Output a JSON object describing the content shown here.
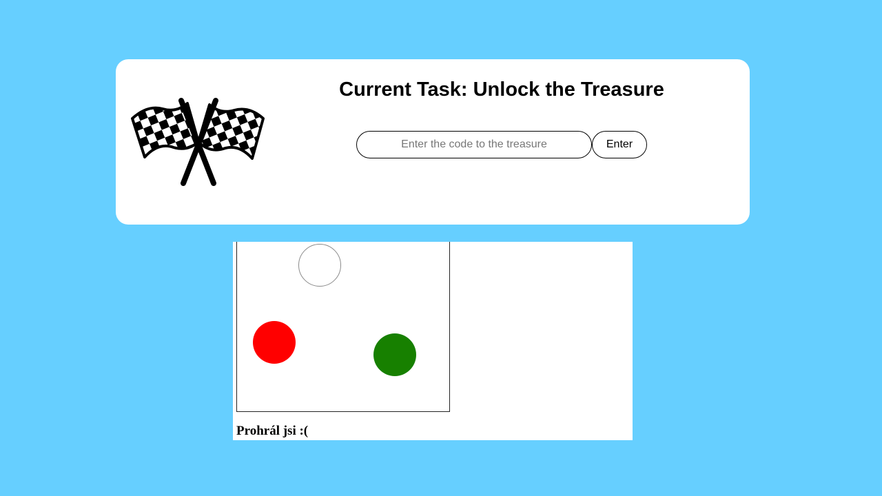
{
  "task": {
    "title": "Current Task: Unlock the Treasure",
    "icon": "checkered-flags-icon"
  },
  "code_form": {
    "input_value": "",
    "input_placeholder": "Enter the code to the treasure",
    "submit_label": "Enter"
  },
  "game": {
    "status_text": "Prohrál jsi :(",
    "balls": [
      {
        "name": "target",
        "fill": "#ffffff",
        "outline": "#8a8a8a"
      },
      {
        "name": "red",
        "fill": "#ff0000"
      },
      {
        "name": "green",
        "fill": "#178000"
      }
    ]
  },
  "colors": {
    "background": "#66cfff",
    "card": "#ffffff",
    "text": "#000000"
  }
}
